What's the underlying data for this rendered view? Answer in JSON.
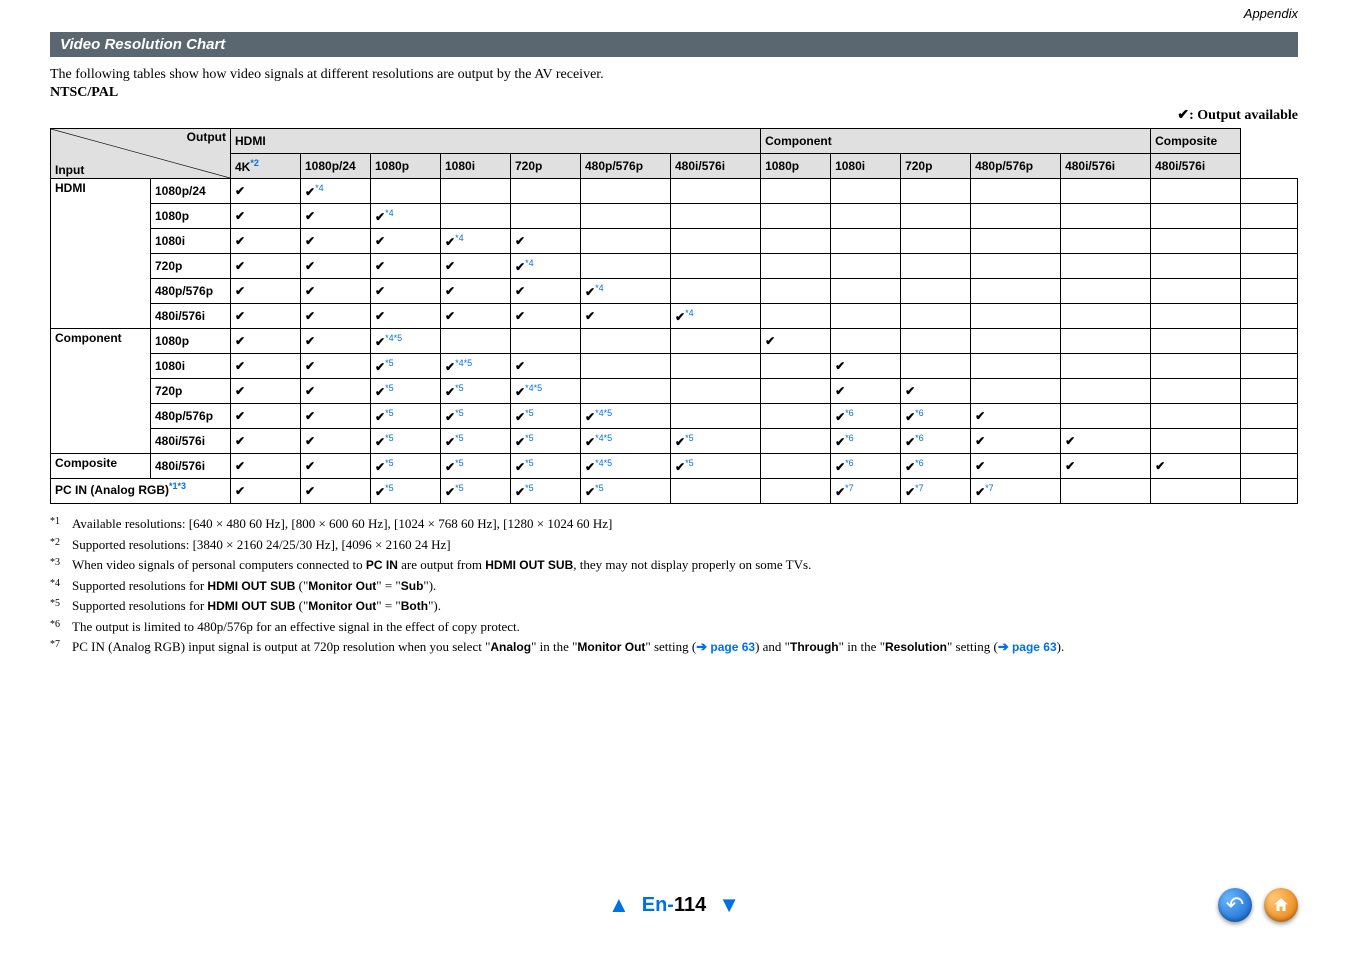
{
  "header": {
    "appendix": "Appendix",
    "section_title": "Video Resolution Chart",
    "intro": "The following tables show how video signals at different resolutions are output by the AV receiver.",
    "subhead": "NTSC/PAL",
    "legend": "✔: Output available"
  },
  "table": {
    "diag_output": "Output",
    "diag_input": "Input",
    "groups": {
      "hdmi": "HDMI",
      "component": "Component",
      "composite": "Composite"
    },
    "cols": {
      "hdmi": [
        "4K",
        "1080p/24",
        "1080p",
        "1080i",
        "720p",
        "480p/576p",
        "480i/576i"
      ],
      "hdmi_4k_sup": "*2",
      "component": [
        "1080p",
        "1080i",
        "720p",
        "480p/576p",
        "480i/576i"
      ],
      "composite": [
        "480i/576i"
      ]
    },
    "row_groups": [
      {
        "name": "HDMI",
        "rows": [
          {
            "label": "1080p/24",
            "cells": [
              "c",
              "c*4",
              "",
              "",
              "",
              "",
              "",
              "",
              "",
              "",
              "",
              "",
              "",
              ""
            ]
          },
          {
            "label": "1080p",
            "cells": [
              "c",
              "c",
              "c*4",
              "",
              "",
              "",
              "",
              "",
              "",
              "",
              "",
              "",
              "",
              ""
            ]
          },
          {
            "label": "1080i",
            "cells": [
              "c",
              "c",
              "c",
              "c*4",
              "c",
              "",
              "",
              "",
              "",
              "",
              "",
              "",
              "",
              ""
            ]
          },
          {
            "label": "720p",
            "cells": [
              "c",
              "c",
              "c",
              "c",
              "c*4",
              "",
              "",
              "",
              "",
              "",
              "",
              "",
              "",
              ""
            ]
          },
          {
            "label": "480p/576p",
            "cells": [
              "c",
              "c",
              "c",
              "c",
              "c",
              "c*4",
              "",
              "",
              "",
              "",
              "",
              "",
              "",
              ""
            ]
          },
          {
            "label": "480i/576i",
            "cells": [
              "c",
              "c",
              "c",
              "c",
              "c",
              "c",
              "c*4",
              "",
              "",
              "",
              "",
              "",
              "",
              ""
            ]
          }
        ]
      },
      {
        "name": "Component",
        "rows": [
          {
            "label": "1080p",
            "cells": [
              "c",
              "c",
              "c*4*5",
              "",
              "",
              "",
              "",
              "c",
              "",
              "",
              "",
              "",
              "",
              ""
            ]
          },
          {
            "label": "1080i",
            "cells": [
              "c",
              "c",
              "c*5",
              "c*4*5",
              "c",
              "",
              "",
              "",
              "c",
              "",
              "",
              "",
              "",
              ""
            ]
          },
          {
            "label": "720p",
            "cells": [
              "c",
              "c",
              "c*5",
              "c*5",
              "c*4*5",
              "",
              "",
              "",
              "c",
              "c",
              "",
              "",
              "",
              ""
            ]
          },
          {
            "label": "480p/576p",
            "cells": [
              "c",
              "c",
              "c*5",
              "c*5",
              "c*5",
              "c*4*5",
              "",
              "",
              "c*6",
              "c*6",
              "c",
              "",
              "",
              ""
            ]
          },
          {
            "label": "480i/576i",
            "cells": [
              "c",
              "c",
              "c*5",
              "c*5",
              "c*5",
              "c*4*5",
              "c*5",
              "",
              "c*6",
              "c*6",
              "c",
              "c",
              "",
              ""
            ]
          }
        ]
      },
      {
        "name": "Composite",
        "rows": [
          {
            "label": "480i/576i",
            "cells": [
              "c",
              "c",
              "c*5",
              "c*5",
              "c*5",
              "c*4*5",
              "c*5",
              "",
              "c*6",
              "c*6",
              "c",
              "c",
              "c",
              ""
            ]
          }
        ]
      },
      {
        "name_full": "PC IN (Analog RGB)",
        "sup": "*1*3",
        "rows": [
          {
            "label": "",
            "cells": [
              "c",
              "c",
              "c*5",
              "c*5",
              "c*5",
              "c*5",
              "",
              "",
              "c*7",
              "c*7",
              "c*7",
              "",
              "",
              ""
            ]
          }
        ]
      }
    ]
  },
  "footnotes": [
    {
      "k": "*1",
      "t_parts": [
        {
          "txt": "Available resolutions: [640 × 480 60 Hz], [800 × 600 60 Hz], [1024 × 768 60 Hz], [1280 × 1024 60 Hz]"
        }
      ]
    },
    {
      "k": "*2",
      "t_parts": [
        {
          "txt": "Supported resolutions: [3840 × 2160 24/25/30 Hz], [4096 × 2160 24 Hz]"
        }
      ]
    },
    {
      "k": "*3",
      "t_parts": [
        {
          "txt": "When video signals of personal computers connected to "
        },
        {
          "b": "PC IN"
        },
        {
          "txt": " are output from "
        },
        {
          "b": "HDMI OUT SUB"
        },
        {
          "txt": ", they may not display properly on some TVs."
        }
      ]
    },
    {
      "k": "*4",
      "t_parts": [
        {
          "txt": "Supported resolutions for "
        },
        {
          "b": "HDMI OUT SUB"
        },
        {
          "txt": " (\""
        },
        {
          "b": "Monitor Out"
        },
        {
          "txt": "\" = \""
        },
        {
          "b": "Sub"
        },
        {
          "txt": "\")."
        }
      ]
    },
    {
      "k": "*5",
      "t_parts": [
        {
          "txt": "Supported resolutions for "
        },
        {
          "b": "HDMI OUT SUB"
        },
        {
          "txt": " (\""
        },
        {
          "b": "Monitor Out"
        },
        {
          "txt": "\" = \""
        },
        {
          "b": "Both"
        },
        {
          "txt": "\")."
        }
      ]
    },
    {
      "k": "*6",
      "t_parts": [
        {
          "txt": "The output is limited to 480p/576p for an effective signal in the effect of copy protect."
        }
      ]
    },
    {
      "k": "*7",
      "t_parts": [
        {
          "txt": "PC IN (Analog RGB) input signal is output at 720p resolution when you select \""
        },
        {
          "b": "Analog"
        },
        {
          "txt": "\" in the \""
        },
        {
          "b": "Monitor Out"
        },
        {
          "txt": "\" setting ("
        },
        {
          "arrow": "➔ "
        },
        {
          "link": "page 63"
        },
        {
          "txt": ") and \""
        },
        {
          "b": "Through"
        },
        {
          "txt": "\" in the \""
        },
        {
          "b": "Resolution"
        },
        {
          "txt": "\" setting ("
        },
        {
          "arrow": "➔ "
        },
        {
          "link": "page 63"
        },
        {
          "txt": ")."
        }
      ]
    }
  ],
  "footer": {
    "page_prefix": "En-",
    "page_number": "114"
  },
  "chart_data": {
    "type": "table",
    "title": "Video Resolution Chart — NTSC/PAL",
    "legend": "✔ = Output available; superscripts reference footnotes *1–*7",
    "output_columns": {
      "HDMI": [
        "4K*2",
        "1080p/24",
        "1080p",
        "1080i",
        "720p",
        "480p/576p",
        "480i/576i"
      ],
      "Component": [
        "1080p",
        "1080i",
        "720p",
        "480p/576p",
        "480i/576i"
      ],
      "Composite": [
        "480i/576i"
      ]
    },
    "rows": [
      {
        "input_group": "HDMI",
        "input": "1080p/24",
        "HDMI": {
          "4K": "✔",
          "1080p/24": "✔*4"
        }
      },
      {
        "input_group": "HDMI",
        "input": "1080p",
        "HDMI": {
          "4K": "✔",
          "1080p/24": "✔",
          "1080p": "✔*4"
        }
      },
      {
        "input_group": "HDMI",
        "input": "1080i",
        "HDMI": {
          "4K": "✔",
          "1080p/24": "✔",
          "1080p": "✔",
          "1080i": "✔*4",
          "720p": "✔"
        }
      },
      {
        "input_group": "HDMI",
        "input": "720p",
        "HDMI": {
          "4K": "✔",
          "1080p/24": "✔",
          "1080p": "✔",
          "1080i": "✔",
          "720p": "✔*4"
        }
      },
      {
        "input_group": "HDMI",
        "input": "480p/576p",
        "HDMI": {
          "4K": "✔",
          "1080p/24": "✔",
          "1080p": "✔",
          "1080i": "✔",
          "720p": "✔",
          "480p/576p": "✔*4"
        }
      },
      {
        "input_group": "HDMI",
        "input": "480i/576i",
        "HDMI": {
          "4K": "✔",
          "1080p/24": "✔",
          "1080p": "✔",
          "1080i": "✔",
          "720p": "✔",
          "480p/576p": "✔",
          "480i/576i": "✔*4"
        }
      },
      {
        "input_group": "Component",
        "input": "1080p",
        "HDMI": {
          "4K": "✔",
          "1080p/24": "✔",
          "1080p": "✔*4*5"
        },
        "Component": {
          "1080p": "✔"
        }
      },
      {
        "input_group": "Component",
        "input": "1080i",
        "HDMI": {
          "4K": "✔",
          "1080p/24": "✔",
          "1080p": "✔*5",
          "1080i": "✔*4*5",
          "720p": "✔"
        },
        "Component": {
          "1080i": "✔"
        }
      },
      {
        "input_group": "Component",
        "input": "720p",
        "HDMI": {
          "4K": "✔",
          "1080p/24": "✔",
          "1080p": "✔*5",
          "1080i": "✔*5",
          "720p": "✔*4*5"
        },
        "Component": {
          "1080i": "✔",
          "720p": "✔"
        }
      },
      {
        "input_group": "Component",
        "input": "480p/576p",
        "HDMI": {
          "4K": "✔",
          "1080p/24": "✔",
          "1080p": "✔*5",
          "1080i": "✔*5",
          "720p": "✔*5",
          "480p/576p": "✔*4*5"
        },
        "Component": {
          "1080i": "✔*6",
          "720p": "✔*6",
          "480p/576p": "✔"
        }
      },
      {
        "input_group": "Component",
        "input": "480i/576i",
        "HDMI": {
          "4K": "✔",
          "1080p/24": "✔",
          "1080p": "✔*5",
          "1080i": "✔*5",
          "720p": "✔*5",
          "480p/576p": "✔*4*5",
          "480i/576i": "✔*5"
        },
        "Component": {
          "1080i": "✔*6",
          "720p": "✔*6",
          "480p/576p": "✔",
          "480i/576i": "✔"
        }
      },
      {
        "input_group": "Composite",
        "input": "480i/576i",
        "HDMI": {
          "4K": "✔",
          "1080p/24": "✔",
          "1080p": "✔*5",
          "1080i": "✔*5",
          "720p": "✔*5",
          "480p/576p": "✔*4*5",
          "480i/576i": "✔*5"
        },
        "Component": {
          "1080i": "✔*6",
          "720p": "✔*6",
          "480p/576p": "✔",
          "480i/576i": "✔"
        },
        "Composite": {
          "480i/576i": "✔"
        }
      },
      {
        "input_group": "PC IN (Analog RGB)*1*3",
        "input": "",
        "HDMI": {
          "4K": "✔",
          "1080p/24": "✔",
          "1080p": "✔*5",
          "1080i": "✔*5",
          "720p": "✔*5",
          "480p/576p": "✔*5"
        },
        "Component": {
          "1080i": "✔*7",
          "720p": "✔*7",
          "480p/576p": "✔*7"
        }
      }
    ]
  }
}
